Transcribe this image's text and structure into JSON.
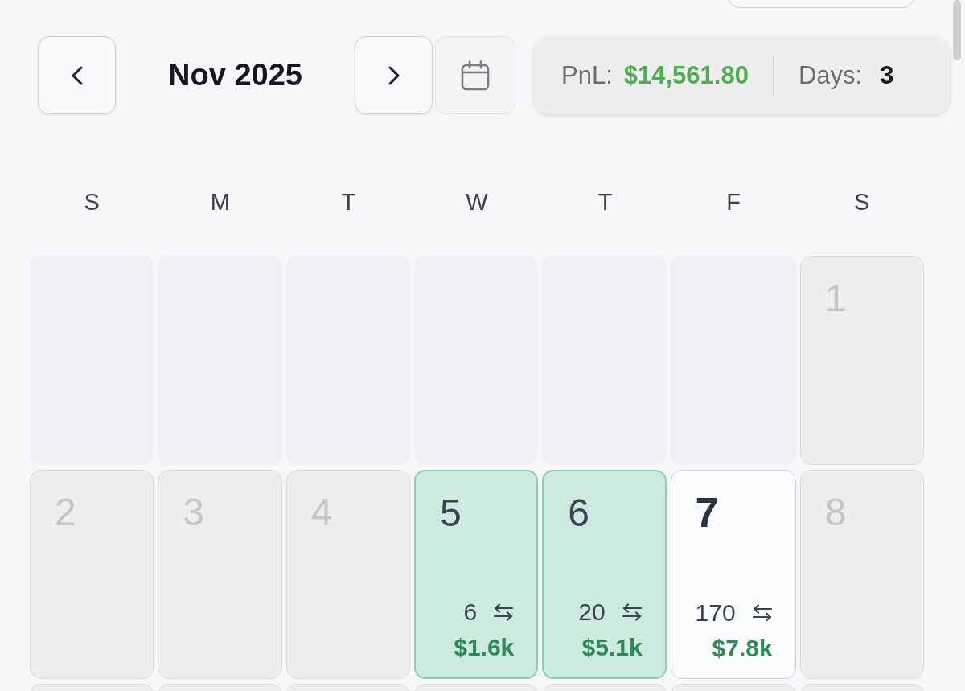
{
  "header": {
    "month_label": "Nov 2025",
    "summary": {
      "pnl_label": "PnL:",
      "pnl_value": "$14,561.80",
      "days_label": "Days:",
      "days_value": "3"
    }
  },
  "weekdays": [
    "S",
    "M",
    "T",
    "W",
    "T",
    "F",
    "S"
  ],
  "weeks": [
    [
      {
        "kind": "blank"
      },
      {
        "kind": "blank"
      },
      {
        "kind": "blank"
      },
      {
        "kind": "blank"
      },
      {
        "kind": "blank"
      },
      {
        "kind": "blank"
      },
      {
        "kind": "inactive",
        "day": "1"
      }
    ],
    [
      {
        "kind": "inactive",
        "day": "2"
      },
      {
        "kind": "inactive",
        "day": "3"
      },
      {
        "kind": "inactive",
        "day": "4"
      },
      {
        "kind": "profit",
        "day": "5",
        "trades": "6",
        "pnl": "$1.6k"
      },
      {
        "kind": "profit",
        "day": "6",
        "trades": "20",
        "pnl": "$5.1k"
      },
      {
        "kind": "today",
        "day": "7",
        "trades": "170",
        "pnl": "$7.8k"
      },
      {
        "kind": "inactive",
        "day": "8"
      }
    ],
    [
      {
        "kind": "inactive"
      },
      {
        "kind": "inactive"
      },
      {
        "kind": "inactive"
      },
      {
        "kind": "inactive"
      },
      {
        "kind": "inactive"
      },
      {
        "kind": "inactive"
      },
      {
        "kind": "inactive"
      }
    ]
  ]
}
